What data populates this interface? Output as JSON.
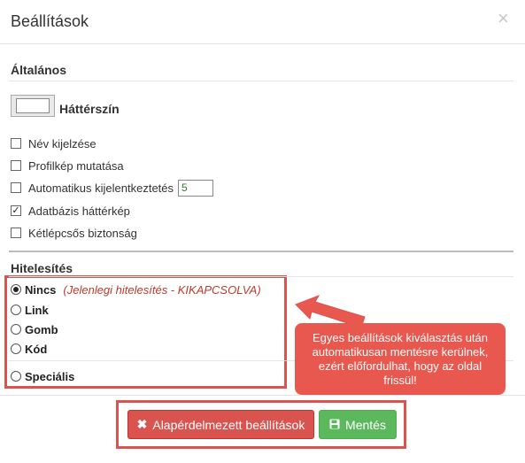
{
  "modal": {
    "title": "Beállítások",
    "close_glyph": "×"
  },
  "general": {
    "title": "Általános",
    "background_color_label": "Háttérszín",
    "options": [
      {
        "label": "Név kijelzése",
        "checked": false
      },
      {
        "label": "Profilkép mutatása",
        "checked": false
      },
      {
        "label": "Automatikus kijelentkeztetés",
        "checked": false,
        "value": "5"
      },
      {
        "label": "Adatbázis háttérkép",
        "checked": true
      },
      {
        "label": "Kétlépcsős biztonság",
        "checked": false
      }
    ]
  },
  "auth": {
    "title": "Hitelesítés",
    "options": [
      {
        "label": "Nincs",
        "selected": true,
        "note": "(Jelenlegi hitelesítés - KIKAPCSOLVA)"
      },
      {
        "label": "Link",
        "selected": false
      },
      {
        "label": "Gomb",
        "selected": false
      },
      {
        "label": "Kód",
        "selected": false
      },
      {
        "label": "Speciális",
        "selected": false
      }
    ]
  },
  "callout": {
    "text": "Egyes beállítások kiválasztás után automatikusan mentésre kerülnek, ezért előfordulhat, hogy az oldal frissül!"
  },
  "footer": {
    "reset_label": "Alapérdelmezett beállítások",
    "reset_icon": "times-icon",
    "save_label": "Mentés",
    "save_icon": "floppy-icon"
  },
  "colors": {
    "danger": "#d9534f",
    "success": "#5cb85c",
    "annotation_red": "#e8584f",
    "note_text": "#c0392b"
  }
}
